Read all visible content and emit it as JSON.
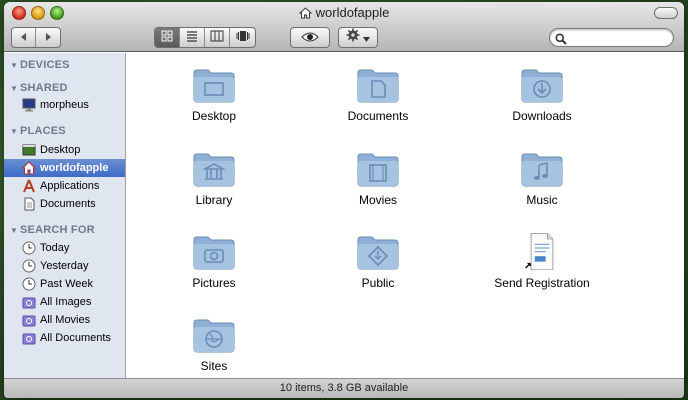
{
  "window": {
    "title": "worldofapple"
  },
  "toolbar": {
    "search_placeholder": ""
  },
  "sidebar": {
    "sections": [
      {
        "heading": "DEVICES",
        "items": []
      },
      {
        "heading": "SHARED",
        "items": [
          {
            "label": "morpheus",
            "icon": "computer-icon"
          }
        ]
      },
      {
        "heading": "PLACES",
        "items": [
          {
            "label": "Desktop",
            "icon": "desktop-icon"
          },
          {
            "label": "worldofapple",
            "icon": "home-icon",
            "selected": true
          },
          {
            "label": "Applications",
            "icon": "applications-icon"
          },
          {
            "label": "Documents",
            "icon": "document-icon"
          }
        ]
      },
      {
        "heading": "SEARCH FOR",
        "items": [
          {
            "label": "Today",
            "icon": "clock-icon"
          },
          {
            "label": "Yesterday",
            "icon": "clock-icon"
          },
          {
            "label": "Past Week",
            "icon": "clock-icon"
          },
          {
            "label": "All Images",
            "icon": "smart-folder-icon"
          },
          {
            "label": "All Movies",
            "icon": "smart-folder-icon"
          },
          {
            "label": "All Documents",
            "icon": "smart-folder-icon"
          }
        ]
      }
    ]
  },
  "content": {
    "items": [
      {
        "label": "Desktop",
        "icon": "desktop-folder-icon"
      },
      {
        "label": "Documents",
        "icon": "documents-folder-icon"
      },
      {
        "label": "Downloads",
        "icon": "downloads-folder-icon"
      },
      {
        "label": "Library",
        "icon": "library-folder-icon"
      },
      {
        "label": "Movies",
        "icon": "movies-folder-icon"
      },
      {
        "label": "Music",
        "icon": "music-folder-icon"
      },
      {
        "label": "Pictures",
        "icon": "pictures-folder-icon"
      },
      {
        "label": "Public",
        "icon": "public-folder-icon"
      },
      {
        "label": "Send Registration",
        "icon": "registration-alias-icon"
      },
      {
        "label": "Sites",
        "icon": "sites-folder-icon"
      }
    ]
  },
  "status": {
    "text": "10 items, 3.8 GB available"
  },
  "colors": {
    "folder": "#8fb0d4",
    "selection": "#3d6bc7",
    "sidebar_bg": "#e0e6ef"
  }
}
